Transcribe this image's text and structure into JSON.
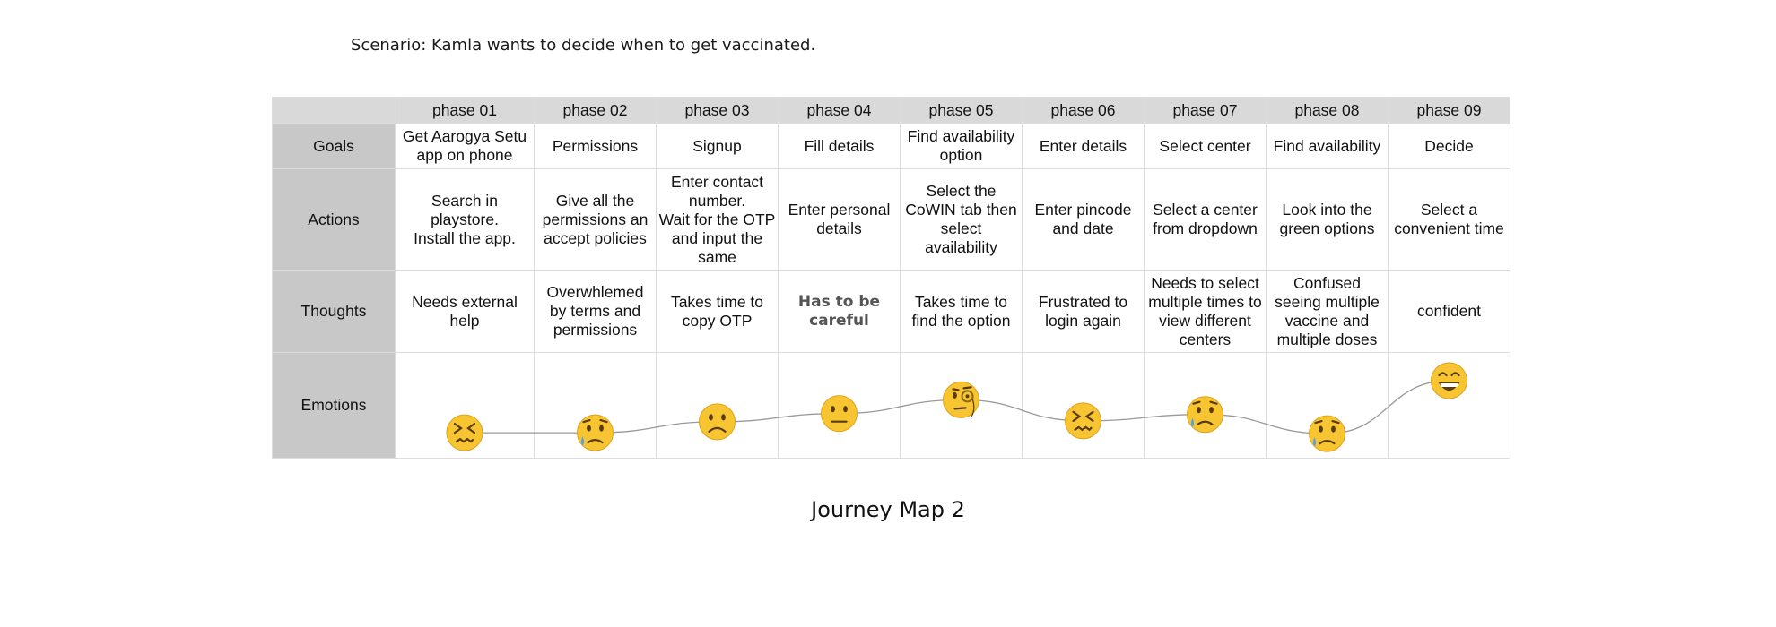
{
  "scenario": "Scenario: Kamla wants to decide when to get vaccinated.",
  "caption": "Journey Map 2",
  "phases": [
    "phase 01",
    "phase 02",
    "phase 03",
    "phase 04",
    "phase 05",
    "phase 06",
    "phase 07",
    "phase 08",
    "phase 09"
  ],
  "row_labels": {
    "goals": "Goals",
    "actions": "Actions",
    "thoughts": "Thoughts",
    "emotions": "Emotions"
  },
  "goals": [
    "Get Aarogya Setu app on phone",
    "Permissions",
    "Signup",
    "Fill details",
    "Find availability option",
    "Enter details",
    "Select center",
    "Find availability",
    "Decide"
  ],
  "actions": [
    "Search in playstore.\nInstall the app.",
    "Give all the permissions an accept policies",
    "Enter contact number.\nWait for the OTP and input the same",
    "Enter personal details",
    "Select the CoWIN tab then select availability",
    "Enter pincode and date",
    "Select a center from dropdown",
    "Look into the green options",
    "Select a convenient time"
  ],
  "thoughts": [
    "Needs external help",
    "Overwhlemed by terms and permissions",
    "Takes time to copy OTP",
    "Has to be careful",
    "Takes time to find the option",
    "Frustrated to login again",
    "Needs to select multiple times to view different centers",
    "Confused seeing multiple vaccine and multiple doses",
    "confident"
  ],
  "emotions": [
    {
      "icon": "confounded-face-icon",
      "level": 0.2
    },
    {
      "icon": "sad-relieved-face-icon",
      "level": 0.2
    },
    {
      "icon": "frowning-face-icon",
      "level": 0.32
    },
    {
      "icon": "neutral-face-icon",
      "level": 0.41
    },
    {
      "icon": "monocle-face-icon",
      "level": 0.56
    },
    {
      "icon": "confounded-face-icon",
      "level": 0.33
    },
    {
      "icon": "sad-relieved-face-icon",
      "level": 0.4
    },
    {
      "icon": "sad-relieved-face-icon",
      "level": 0.19
    },
    {
      "icon": "grinning-face-icon",
      "level": 0.77
    }
  ],
  "colors": {
    "header_bg": "#d9d9d9",
    "label_bg": "#c8c8c8",
    "grid": "#dcdcdc",
    "emoji_yellow": "#f7c531",
    "line": "#999999"
  }
}
